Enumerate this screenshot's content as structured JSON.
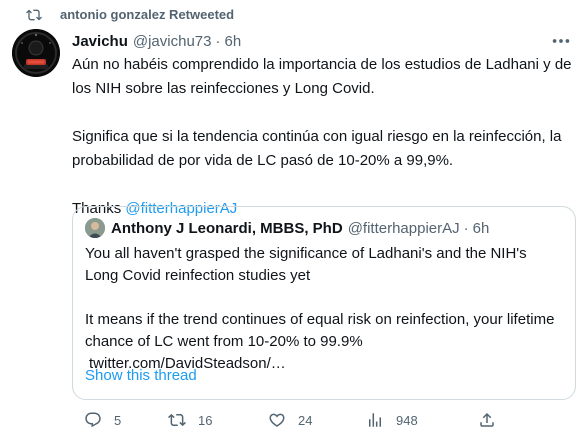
{
  "retweet": {
    "icon": "retweet-icon",
    "text": "antonio gonzalez Retweeted"
  },
  "tweet": {
    "avatar": "user-avatar",
    "display_name": "Javichu",
    "handle": "@javichu73",
    "separator": "·",
    "time": "6h",
    "paragraph1": "Aún no habéis comprendido la importancia de los estudios de Ladhani y de los NIH sobre las reinfecciones y Long Covid.",
    "paragraph2": "Significa que si la tendencia continúa con igual riesgo en la reinfección, la probabilidad de por vida de LC pasó de 10-20% a 99,9%.",
    "thanks_prefix": "Thanks ",
    "thanks_mention": "@fitterhappierAJ"
  },
  "quote": {
    "display_name": "Anthony J Leonardi, MBBS, PhD",
    "handle": "@fitterhappierAJ",
    "separator": "·",
    "time": "6h",
    "paragraph1": "You all haven't grasped the significance of Ladhani's and the NIH's Long Covid reinfection studies yet",
    "paragraph2": "It means if the trend continues of equal risk on reinfection, your lifetime chance of LC went from 10-20% to 99.9%",
    "link": "twitter.com/DavidSteadson/…",
    "show_thread": "Show this thread"
  },
  "actions": {
    "reply_count": "5",
    "retweet_count": "16",
    "like_count": "24",
    "views_count": "948"
  },
  "colors": {
    "link": "#1d9bf0",
    "muted": "#536471",
    "border": "#cfd9de"
  }
}
